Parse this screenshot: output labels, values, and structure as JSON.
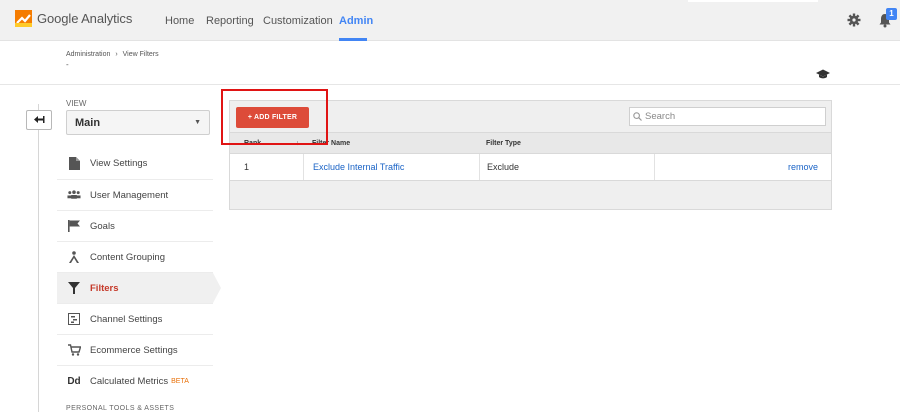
{
  "app": {
    "title": "Google Analytics"
  },
  "nav": {
    "items": [
      {
        "label": "Home"
      },
      {
        "label": "Reporting"
      },
      {
        "label": "Customization"
      },
      {
        "label": "Admin"
      }
    ],
    "active": "Admin"
  },
  "notifications": {
    "count": "1"
  },
  "breadcrumb": {
    "root": "Administration",
    "separator": "›",
    "current": "View Filters",
    "sub": "-"
  },
  "view": {
    "label": "VIEW",
    "selected": "Main"
  },
  "sidebar": {
    "items": [
      {
        "label": "View Settings",
        "icon": "document-icon"
      },
      {
        "label": "User Management",
        "icon": "users-icon"
      },
      {
        "label": "Goals",
        "icon": "flag-icon"
      },
      {
        "label": "Content Grouping",
        "icon": "grouping-icon"
      },
      {
        "label": "Filters",
        "icon": "filter-icon",
        "active": true
      },
      {
        "label": "Channel Settings",
        "icon": "channel-icon"
      },
      {
        "label": "Ecommerce Settings",
        "icon": "cart-icon"
      },
      {
        "label": "Calculated Metrics",
        "icon": "dd-icon",
        "badge": "BETA"
      }
    ],
    "section_personal": "PERSONAL TOOLS & ASSETS"
  },
  "toolbar": {
    "add_filter_label": "+ ADD FILTER"
  },
  "search": {
    "placeholder": "Search"
  },
  "table": {
    "columns": [
      "Rank",
      "Filter Name",
      "Filter Type"
    ],
    "rows": [
      {
        "rank": "1",
        "name": "Exclude Internal Traffic",
        "type": "Exclude",
        "action": "remove"
      }
    ]
  },
  "colors": {
    "accent": "#4285f4",
    "add_button": "#dd4b39",
    "active_item": "#c53929",
    "annotation": "#e01414"
  }
}
